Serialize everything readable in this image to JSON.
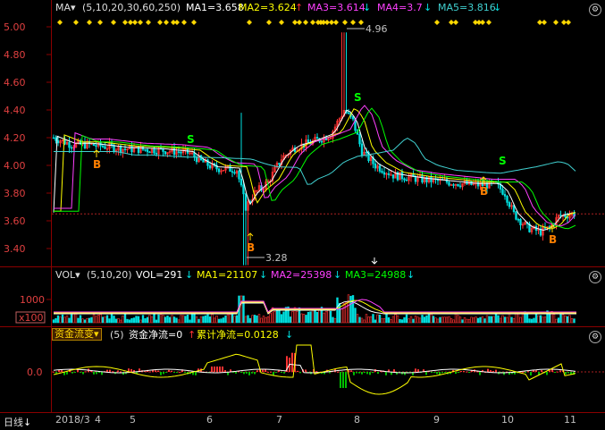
{
  "main": {
    "indicator": "MA",
    "params": "(5,10,20,30,60,250)",
    "ma1": "MA1=3.658",
    "ma2": "MA2=3.624",
    "ma3": "MA3=3.614",
    "ma4": "MA4=3.7",
    "ma5": "MA5=3.816",
    "price_axis": [
      "5.00",
      "4.80",
      "4.60",
      "4.40",
      "4.20",
      "4.00",
      "3.80",
      "3.60",
      "3.40"
    ],
    "high_label": "4.96",
    "low_label": "3.28",
    "buy_marker": "B",
    "sell_marker": "S"
  },
  "volume": {
    "indicator": "VOL",
    "params": "(5,10,20)",
    "vol": "VOL=291",
    "ma1": "MA1=21107",
    "ma2": "MA2=25398",
    "ma3": "MA3=24988",
    "axis_value": "1000",
    "axis_unit": "x100"
  },
  "capital": {
    "menu_label": "资金流变",
    "params": "(5)",
    "net": "资金净流=0",
    "cumulative": "累计净流=0.0128",
    "axis_value": "0.0"
  },
  "timeline": {
    "period_label": "日线",
    "start": "2018/3",
    "months": [
      "4",
      "5",
      "6",
      "7",
      "8",
      "9",
      "10",
      "11"
    ]
  },
  "colors": {
    "up": "#ff3232",
    "down": "#00e0e0",
    "ma1": "#ffffff",
    "ma2": "#ffff00",
    "ma3": "#ff40ff",
    "ma4": "#00ff00",
    "ma5": "#40d0d0",
    "marker": "#ffd700"
  }
}
